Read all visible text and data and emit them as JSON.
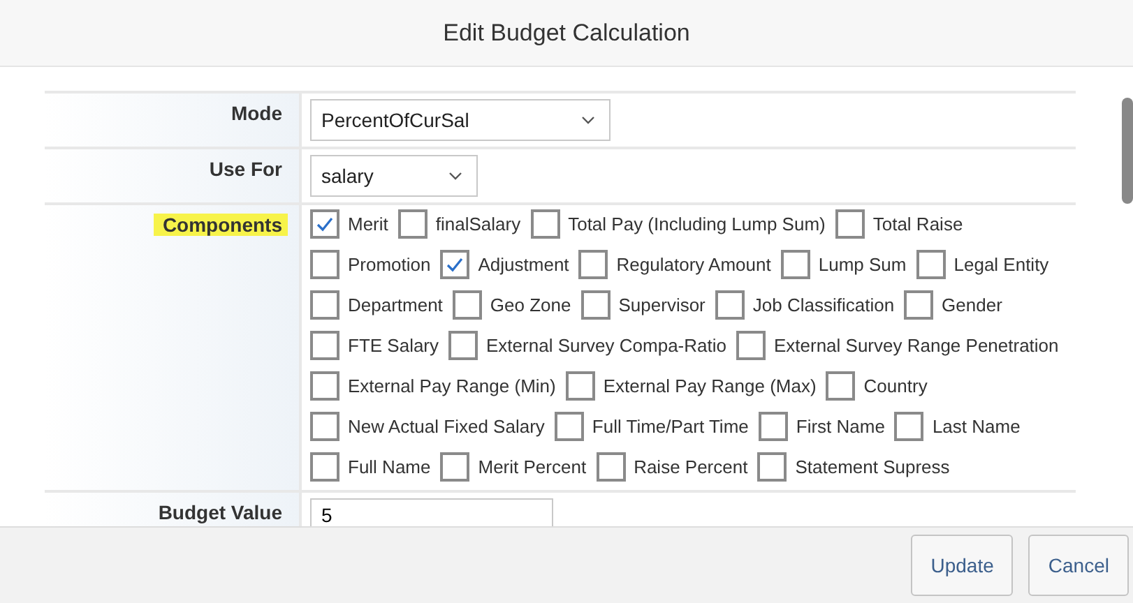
{
  "dialog": {
    "title": "Edit Budget Calculation"
  },
  "form": {
    "mode": {
      "label": "Mode",
      "value": "PercentOfCurSal"
    },
    "use_for": {
      "label": "Use For",
      "value": "salary"
    },
    "components": {
      "label": "Components",
      "lines": [
        [
          {
            "label": "Merit",
            "checked": true
          },
          {
            "label": "finalSalary",
            "checked": false
          },
          {
            "label": "Total Pay (Including Lump Sum)",
            "checked": false
          },
          {
            "label": "Total Raise",
            "checked": false
          }
        ],
        [
          {
            "label": "Promotion",
            "checked": false
          },
          {
            "label": "Adjustment",
            "checked": true
          },
          {
            "label": "Regulatory Amount",
            "checked": false
          },
          {
            "label": "Lump Sum",
            "checked": false
          },
          {
            "label": "Legal Entity",
            "checked": false
          }
        ],
        [
          {
            "label": "Department",
            "checked": false
          },
          {
            "label": "Geo Zone",
            "checked": false
          },
          {
            "label": "Supervisor",
            "checked": false
          },
          {
            "label": "Job Classification",
            "checked": false
          },
          {
            "label": "Gender",
            "checked": false
          }
        ],
        [
          {
            "label": "FTE Salary",
            "checked": false
          },
          {
            "label": "External Survey Compa-Ratio",
            "checked": false
          },
          {
            "label": "External Survey Range Penetration",
            "checked": false
          }
        ],
        [
          {
            "label": "External Pay Range (Min)",
            "checked": false
          },
          {
            "label": "External Pay Range (Max)",
            "checked": false
          },
          {
            "label": "Country",
            "checked": false
          }
        ],
        [
          {
            "label": "New Actual Fixed Salary",
            "checked": false
          },
          {
            "label": "Full Time/Part Time",
            "checked": false
          },
          {
            "label": "First Name",
            "checked": false
          },
          {
            "label": "Last Name",
            "checked": false
          }
        ],
        [
          {
            "label": "Full Name",
            "checked": false
          },
          {
            "label": "Merit Percent",
            "checked": false
          },
          {
            "label": "Raise Percent",
            "checked": false
          },
          {
            "label": "Statement Supress",
            "checked": false
          }
        ]
      ]
    },
    "budget_value": {
      "label": "Budget Value",
      "value": "5"
    }
  },
  "buttons": [
    "Update",
    "Cancel"
  ]
}
